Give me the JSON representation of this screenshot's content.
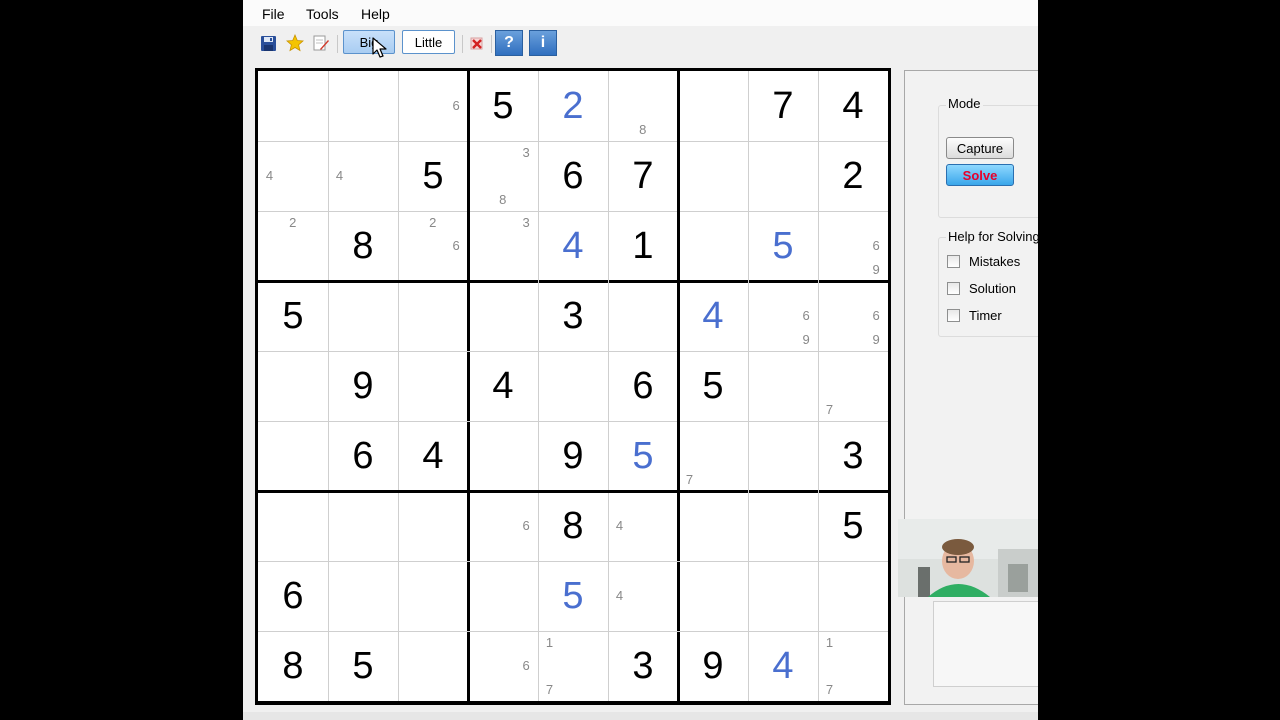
{
  "menu": [
    "File",
    "Tools",
    "Help"
  ],
  "toolbar": {
    "icons": [
      "save-icon",
      "star-icon",
      "edit-document-icon"
    ],
    "big_label": "Big",
    "little_label": "Little",
    "clear_icon": "clear-red-x-icon",
    "help_label": "?",
    "info_label": "i"
  },
  "grid": [
    [
      {
        "c": [
          6
        ]
      },
      {
        "v": 5,
        "t": "g"
      },
      {
        "v": 2,
        "t": "s"
      },
      {
        "c": [
          8
        ]
      },
      {},
      {
        "v": 7,
        "t": "g"
      },
      {
        "v": 4,
        "t": "g"
      }
    ],
    [
      {
        "c": [
          4
        ]
      },
      {
        "c": [
          4
        ]
      },
      {
        "v": 5,
        "t": "g"
      },
      {
        "c": [
          3,
          8
        ]
      },
      {
        "v": 6,
        "t": "g"
      },
      {
        "v": 7,
        "t": "g"
      },
      {},
      {},
      {
        "v": 2,
        "t": "g"
      }
    ],
    [
      {
        "c": [
          2
        ]
      },
      {
        "v": 8,
        "t": "g"
      },
      {
        "c": [
          2,
          6
        ]
      },
      {
        "c": [
          3
        ]
      },
      {
        "v": 4,
        "t": "s"
      },
      {
        "v": 1,
        "t": "g"
      },
      {},
      {
        "v": 5,
        "t": "s"
      },
      {
        "c": [
          6,
          9
        ]
      }
    ],
    [
      {
        "v": 5,
        "t": "g"
      },
      {},
      {},
      {},
      {
        "v": 3,
        "t": "g"
      },
      {},
      {
        "v": 4,
        "t": "s"
      },
      {
        "c": [
          6,
          9
        ]
      },
      {
        "c": [
          6,
          9
        ]
      }
    ],
    [
      {},
      {
        "v": 9,
        "t": "g"
      },
      {},
      {
        "v": 4,
        "t": "g"
      },
      {},
      {
        "v": 6,
        "t": "g"
      },
      {
        "v": 5,
        "t": "g"
      },
      {},
      {
        "c": [
          7
        ]
      }
    ],
    [
      {},
      {
        "v": 6,
        "t": "g"
      },
      {
        "v": 4,
        "t": "g"
      },
      {},
      {
        "v": 9,
        "t": "g"
      },
      {
        "v": 5,
        "t": "s"
      },
      {
        "c": [
          7
        ]
      },
      {},
      {
        "v": 3,
        "t": "g"
      }
    ],
    [
      {},
      {},
      {},
      {
        "c": [
          6
        ]
      },
      {
        "v": 8,
        "t": "g"
      },
      {
        "c": [
          4
        ]
      },
      {},
      {},
      {
        "v": 5,
        "t": "g"
      }
    ],
    [
      {
        "v": 6,
        "t": "g"
      },
      {},
      {},
      {},
      {
        "v": 5,
        "t": "s"
      },
      {
        "c": [
          4
        ]
      },
      {},
      {},
      {}
    ],
    [
      {
        "v": 8,
        "t": "g"
      },
      {
        "v": 5,
        "t": "g"
      },
      {},
      {
        "c": [
          6
        ]
      },
      {
        "c": [
          1,
          7
        ]
      },
      {
        "v": 3,
        "t": "g"
      },
      {
        "v": 9,
        "t": "g"
      },
      {
        "v": 4,
        "t": "s"
      },
      {
        "c": [
          1,
          7
        ]
      }
    ]
  ],
  "side": {
    "mode_label": "Mode",
    "capture_label": "Capture",
    "solve_label": "Solve",
    "help_label": "Help for Solving",
    "checks": [
      {
        "label": "Mistakes",
        "checked": false
      },
      {
        "label": "Solution",
        "checked": false
      },
      {
        "label": "Timer",
        "checked": false
      }
    ]
  },
  "colors": {
    "given": "#000000",
    "solved": "#4a6fcf",
    "candidate": "#888888",
    "solve_text": "#e8002a"
  }
}
